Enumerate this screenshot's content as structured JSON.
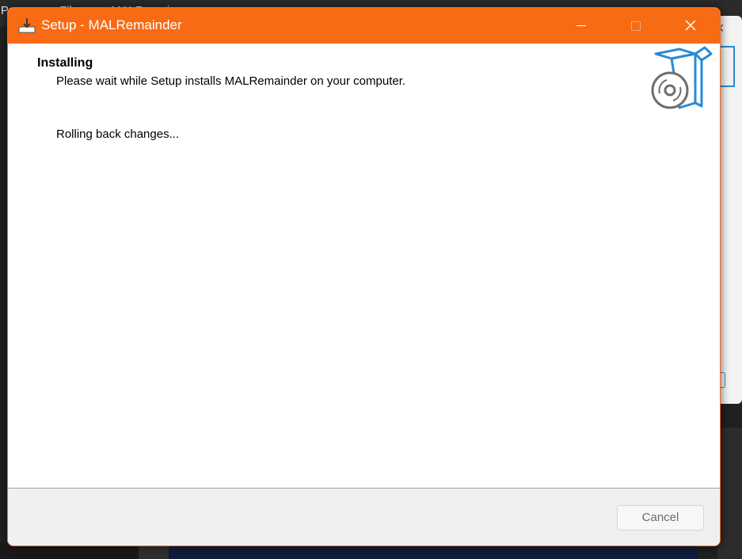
{
  "background": {
    "topbar_items": [
      "Pr",
      "File",
      "MALRemai"
    ]
  },
  "dialog": {
    "title": "Setup - MALRemainder",
    "heading": "Installing",
    "subheading": "Please wait while Setup installs MALRemainder on your computer.",
    "status": "Rolling back changes...",
    "cancel_label": "Cancel"
  },
  "icons": {
    "app": "installer-icon",
    "minimize": "minimize-icon",
    "maximize": "maximize-icon",
    "close": "close-icon",
    "wizard": "box-disc-icon"
  },
  "colors": {
    "titlebar": "#f76b15",
    "accent_blue": "#2a8ad4",
    "footer": "#f0f0f0"
  }
}
